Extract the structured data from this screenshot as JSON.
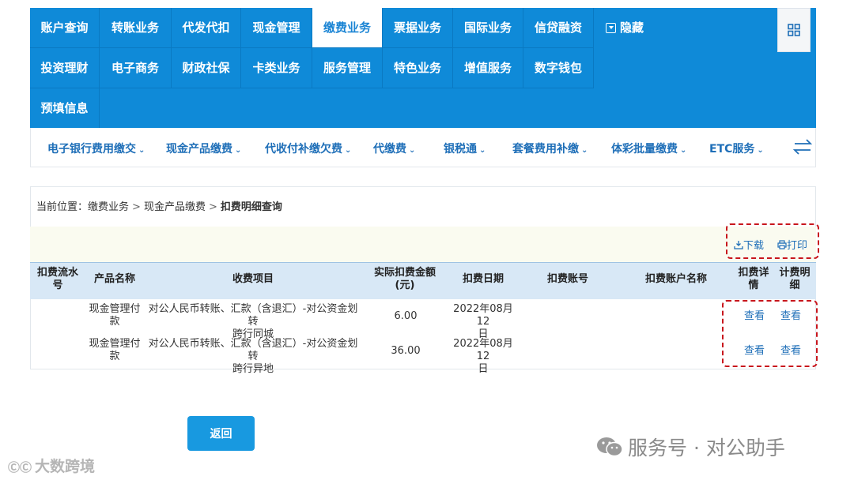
{
  "topnav": {
    "row1": [
      "账户查询",
      "转账业务",
      "代发代扣",
      "现金管理",
      "缴费业务",
      "票据业务",
      "国际业务",
      "信贷融资"
    ],
    "row2": [
      "投资理财",
      "电子商务",
      "财政社保",
      "卡类业务",
      "服务管理",
      "特色业务",
      "增值服务",
      "数字钱包"
    ],
    "row3": [
      "预填信息"
    ],
    "active": "缴费业务",
    "hide_label": "隐藏"
  },
  "subnav": {
    "items": [
      "电子银行费用缴交",
      "现金产品缴费",
      "代收付补缴欠费",
      "代缴费",
      "银税通",
      "套餐费用补缴",
      "体彩批量缴费",
      "ETC服务"
    ]
  },
  "breadcrumb": {
    "prefix": "当前位置：",
    "path": [
      "缴费业务",
      "现金产品缴费"
    ],
    "current": "扣费明细查询"
  },
  "toolbar": {
    "download_label": "下载",
    "print_label": "打印"
  },
  "table": {
    "headers": {
      "serial": [
        "扣费流水",
        "号"
      ],
      "product": "产品名称",
      "item": "收费项目",
      "amount": [
        "实际扣费金额",
        "(元)"
      ],
      "date": "扣费日期",
      "account": "扣费账号",
      "account_name": "扣费账户名称",
      "detail": [
        "扣费详",
        "情"
      ],
      "calc": [
        "计费明",
        "细"
      ]
    },
    "rows": [
      {
        "serial": "",
        "product": [
          "现金管理付",
          "款"
        ],
        "item": [
          "对公人民币转账、汇款（含退汇）-对公资金划转",
          "跨行同城"
        ],
        "amount": "6.00",
        "date": [
          "2022年08月12",
          "日"
        ],
        "account": "",
        "account_name": "",
        "detail": "查看",
        "calc": "查看"
      },
      {
        "serial": "",
        "product": [
          "现金管理付",
          "款"
        ],
        "item": [
          "对公人民币转账、汇款（含退汇）-对公资金划转",
          "跨行异地"
        ],
        "amount": "36.00",
        "date": [
          "2022年08月12",
          "日"
        ],
        "account": "",
        "account_name": "",
        "detail": "查看",
        "calc": "查看"
      }
    ]
  },
  "buttons": {
    "back_label": "返回"
  },
  "watermarks": {
    "right": "服务号 · 对公助手",
    "left": "大数跨境"
  },
  "colors": {
    "nav_blue": "#0f8ad8",
    "link_blue": "#1f6fb8",
    "highlight_red": "#c8161d",
    "header_bg": "#d8e8f6"
  },
  "icons": {
    "grid": "grid-icon",
    "hide": "collapse-icon",
    "swap": "swap-arrows-icon",
    "download": "download-icon",
    "print": "printer-icon",
    "wechat": "wechat-icon"
  }
}
